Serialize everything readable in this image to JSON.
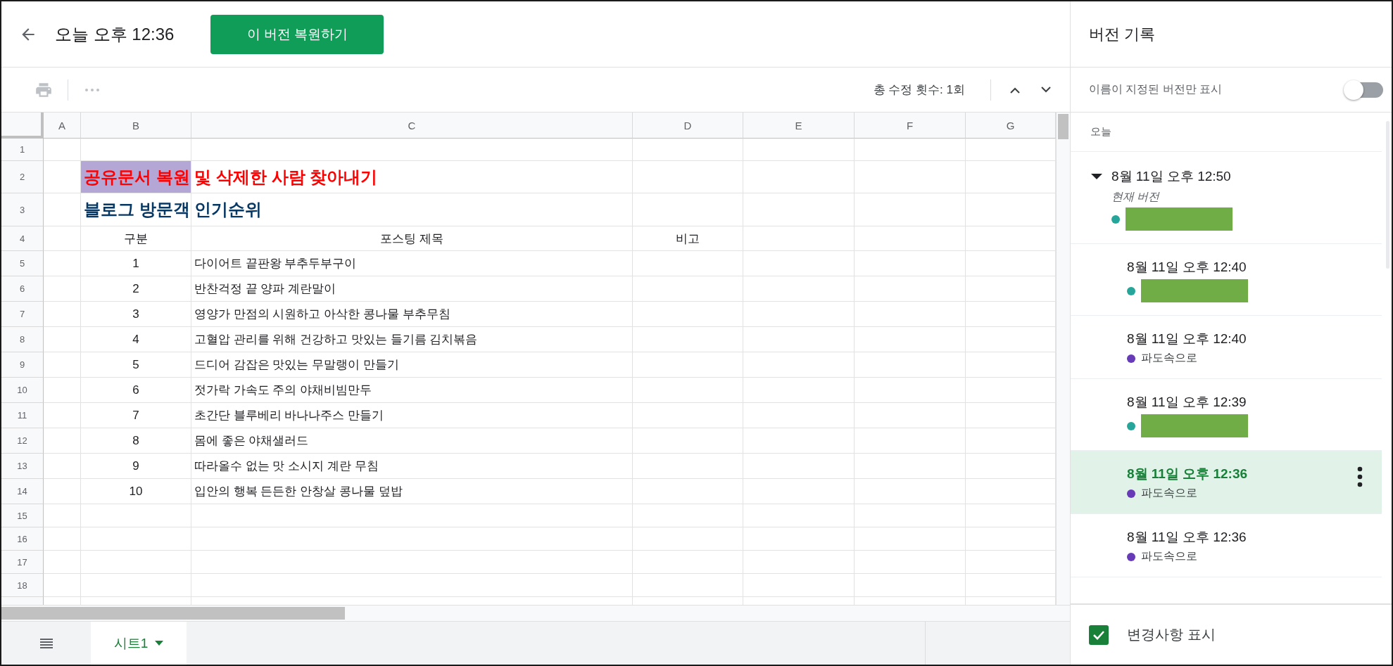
{
  "top_bar": {
    "title": "오늘 오후 12:36",
    "restore_button": "이 버전 복원하기"
  },
  "toolbar": {
    "edit_count": "총 수정 횟수: 1회"
  },
  "sheet": {
    "columns": [
      "A",
      "B",
      "C",
      "D",
      "E",
      "F",
      "G"
    ],
    "rows": [
      {
        "number": "1",
        "kind": "blank",
        "highlighted": false,
        "cells": {}
      },
      {
        "number": "2",
        "kind": "title",
        "highlighted": true,
        "cells": {
          "B": "공유문서 복원 및 삭제한 사람 찾아내기"
        }
      },
      {
        "number": "3",
        "kind": "subtitle",
        "highlighted": false,
        "cells": {
          "B": "블로그 방문객 인기순위"
        }
      },
      {
        "number": "4",
        "kind": "header",
        "highlighted": false,
        "cells": {
          "B": "구분",
          "C": "포스팅 제목",
          "D": "비고"
        }
      },
      {
        "number": "5",
        "kind": "data",
        "highlighted": false,
        "cells": {
          "B": "1",
          "C": "다이어트 끝판왕 부추두부구이"
        }
      },
      {
        "number": "6",
        "kind": "data",
        "highlighted": false,
        "cells": {
          "B": "2",
          "C": "반찬걱정 끝 양파 계란말이"
        }
      },
      {
        "number": "7",
        "kind": "data",
        "highlighted": false,
        "cells": {
          "B": "3",
          "C": "영양가 만점의 시원하고 아삭한 콩나물 부추무침"
        }
      },
      {
        "number": "8",
        "kind": "data",
        "highlighted": false,
        "cells": {
          "B": "4",
          "C": "고혈압 관리를 위해 건강하고 맛있는 들기름 김치볶음"
        }
      },
      {
        "number": "9",
        "kind": "data",
        "highlighted": false,
        "cells": {
          "B": "5",
          "C": "드디어 감잡은 맛있는 무말랭이 만들기"
        }
      },
      {
        "number": "10",
        "kind": "data",
        "highlighted": false,
        "cells": {
          "B": "6",
          "C": "젓가락 가속도 주의 야채비빔만두"
        }
      },
      {
        "number": "11",
        "kind": "data",
        "highlighted": false,
        "cells": {
          "B": "7",
          "C": "초간단 블루베리 바나나주스 만들기"
        }
      },
      {
        "number": "12",
        "kind": "data",
        "highlighted": false,
        "cells": {
          "B": "8",
          "C": "몸에 좋은 야채샐러드"
        }
      },
      {
        "number": "13",
        "kind": "data",
        "highlighted": false,
        "cells": {
          "B": "9",
          "C": "따라올수 없는 맛 소시지 계란 무침"
        }
      },
      {
        "number": "14",
        "kind": "data",
        "highlighted": false,
        "cells": {
          "B": "10",
          "C": "입안의 행복 든든한 안창살 콩나물 덮밥"
        }
      },
      {
        "number": "15",
        "kind": "empty",
        "highlighted": false,
        "cells": {}
      },
      {
        "number": "16",
        "kind": "empty",
        "highlighted": false,
        "cells": {}
      },
      {
        "number": "17",
        "kind": "empty",
        "highlighted": false,
        "cells": {}
      },
      {
        "number": "18",
        "kind": "empty",
        "highlighted": false,
        "cells": {}
      }
    ]
  },
  "sheet_tabs": [
    {
      "label": "시트1",
      "selected": true
    }
  ],
  "panel": {
    "title": "버전 기록",
    "named_only": {
      "label": "이름이 지정된 버전만 표시",
      "on": false
    },
    "group_label": "오늘",
    "versions": [
      {
        "time": "8월 11일 오후 12:50",
        "note": "현재 버전",
        "expanded": true,
        "selected": false,
        "editor": {
          "redacted": true,
          "color": "#26a69a"
        },
        "children": [
          {
            "time": "8월 11일 오후 12:40",
            "selected": false,
            "editor": {
              "redacted": true,
              "color": "#26a69a"
            }
          },
          {
            "time": "8월 11일 오후 12:40",
            "selected": false,
            "editor": {
              "redacted": false,
              "name": "파도속으로",
              "color": "#673ab7"
            }
          },
          {
            "time": "8월 11일 오후 12:39",
            "selected": false,
            "editor": {
              "redacted": true,
              "color": "#26a69a"
            }
          },
          {
            "time": "8월 11일 오후 12:36",
            "selected": true,
            "editor": {
              "redacted": false,
              "name": "파도속으로",
              "color": "#673ab7"
            }
          },
          {
            "time": "8월 11일 오후 12:36",
            "selected": false,
            "editor": {
              "redacted": false,
              "name": "파도속으로",
              "color": "#673ab7"
            }
          }
        ]
      }
    ],
    "show_changes": {
      "label": "변경사항 표시",
      "checked": true
    }
  }
}
